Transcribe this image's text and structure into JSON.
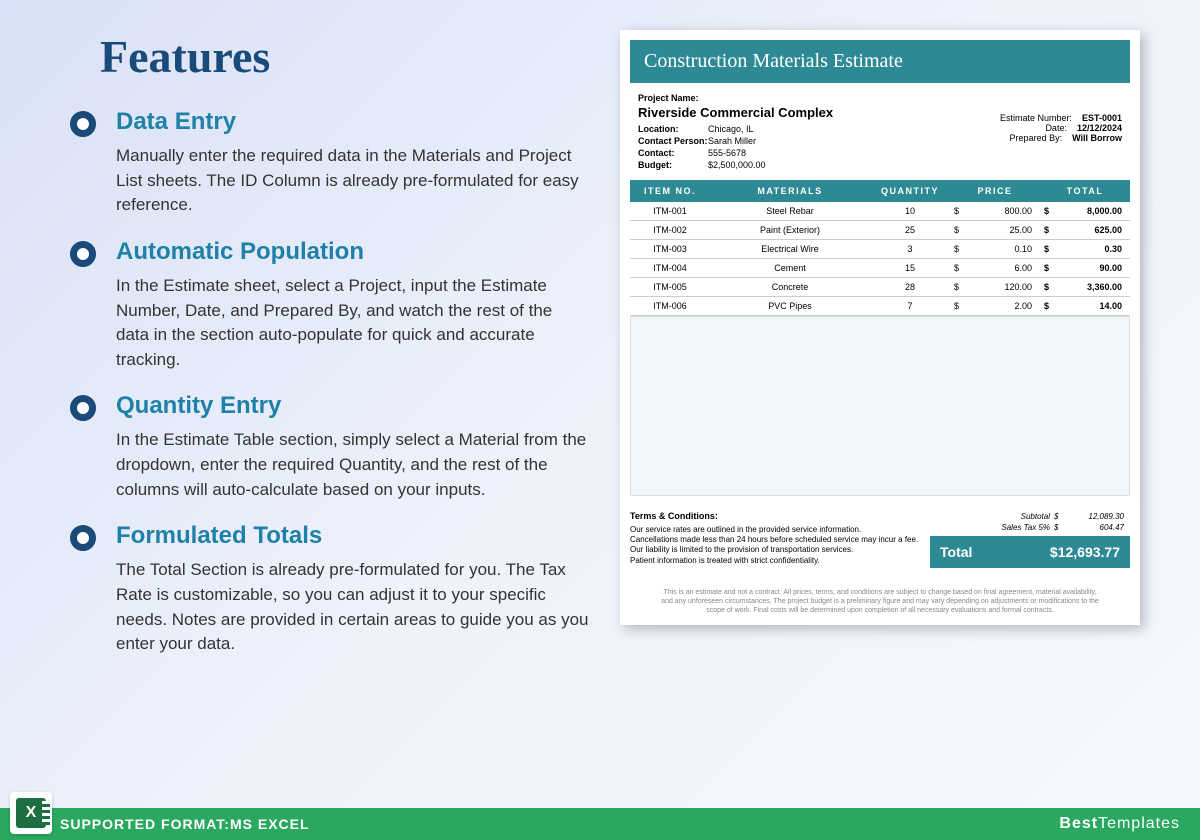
{
  "page_title": "Features",
  "features": [
    {
      "title": "Data Entry",
      "body": "Manually enter the required data in the Materials and Project List sheets. The ID Column is already pre-formulated for easy reference."
    },
    {
      "title": "Automatic Population",
      "body": "In the Estimate sheet, select a Project, input the Estimate Number, Date, and Prepared By, and watch the rest of the data in the section auto-populate for quick and accurate tracking."
    },
    {
      "title": "Quantity Entry",
      "body": "In the Estimate Table section, simply select a Material from the dropdown, enter the required Quantity, and the rest of the columns will auto-calculate based on your inputs."
    },
    {
      "title": "Formulated Totals",
      "body": "The Total Section is already pre-formulated for you. The Tax Rate is customizable, so you can adjust it to your specific needs. Notes are provided in certain areas to guide you as you enter your data."
    }
  ],
  "document": {
    "title": "Construction Materials Estimate",
    "project_name_label": "Project Name:",
    "project_name": "Riverside Commercial Complex",
    "location_label": "Location:",
    "location": "Chicago, IL",
    "contact_person_label": "Contact Person:",
    "contact_person": "Sarah Miller",
    "contact_label": "Contact:",
    "contact": "555-5678",
    "budget_label": "Budget:",
    "budget": "$2,500,000.00",
    "estimate_number_label": "Estimate Number:",
    "estimate_number": "EST-0001",
    "date_label": "Date:",
    "date": "12/12/2024",
    "prepared_by_label": "Prepared By:",
    "prepared_by": "Will Borrow",
    "headers": {
      "item": "ITEM NO.",
      "materials": "MATERIALS",
      "quantity": "QUANTITY",
      "price": "PRICE",
      "total": "TOTAL"
    },
    "rows": [
      {
        "item": "ITM-001",
        "material": "Steel Rebar",
        "qty": "10",
        "price": "800.00",
        "total": "8,000.00"
      },
      {
        "item": "ITM-002",
        "material": "Paint (Exterior)",
        "qty": "25",
        "price": "25.00",
        "total": "625.00"
      },
      {
        "item": "ITM-003",
        "material": "Electrical Wire",
        "qty": "3",
        "price": "0.10",
        "total": "0.30"
      },
      {
        "item": "ITM-004",
        "material": "Cement",
        "qty": "15",
        "price": "6.00",
        "total": "90.00"
      },
      {
        "item": "ITM-005",
        "material": "Concrete",
        "qty": "28",
        "price": "120.00",
        "total": "3,360.00"
      },
      {
        "item": "ITM-006",
        "material": "PVC Pipes",
        "qty": "7",
        "price": "2.00",
        "total": "14.00"
      }
    ],
    "terms_title": "Terms & Conditions:",
    "terms_lines": [
      "Our service rates are outlined in the provided service information.",
      "Cancellations made less than 24 hours before scheduled service may incur a fee.",
      "Our liability is limited to the provision of transportation services.",
      "Patient information is treated with strict confidentiality."
    ],
    "subtotal_label": "Subtotal",
    "subtotal": "12,089.30",
    "tax_label": "Sales Tax   5%",
    "tax": "604.47",
    "total_label": "Total",
    "grand_total": "$12,693.77",
    "disclaimer": "This is an estimate and not a contract. All prices, terms, and conditions are subject to change based on final agreement, material availability, and any unforeseen circumstances. The project budget is a preliminary figure and may vary depending on adjustments or modifications to the scope of work. Final costs will be determined upon completion of all necessary evaluations and formal contracts."
  },
  "footer": {
    "supported_label": "SUPPORTED FORMAT: ",
    "format": "MS EXCEL",
    "brand_bold": "Best",
    "brand_light": "Templates",
    "excel_letter": "X"
  }
}
